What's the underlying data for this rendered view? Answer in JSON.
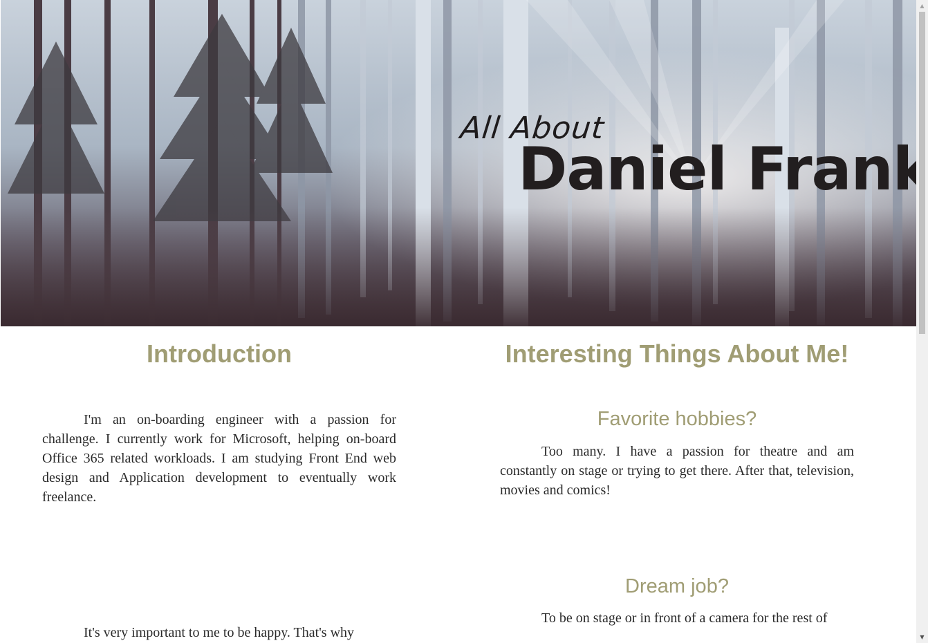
{
  "hero": {
    "kicker": "All About",
    "name": "Daniel Frank"
  },
  "intro": {
    "title": "Introduction",
    "paragraphs": [
      "I'm an on-boarding engineer with a passion for challenge. I currently work for Microsoft, helping on-board Office 365 related workloads. I am studying Front End web design and Application development to eventually work freelance.",
      "It's very important to me to be happy. That's why"
    ]
  },
  "interesting": {
    "title": "Interesting Things About Me!",
    "items": [
      {
        "question": "Favorite hobbies?",
        "answer": "Too many. I have a passion for theatre and am constantly on stage or trying to get there. After that, television, movies and comics!"
      },
      {
        "question": "Dream job?",
        "answer": "To be on stage or in front of a camera for the rest of"
      }
    ]
  },
  "colors": {
    "heading": "#a09d74",
    "body_text": "#2a2a2a",
    "hero_text": "#221e1f"
  }
}
